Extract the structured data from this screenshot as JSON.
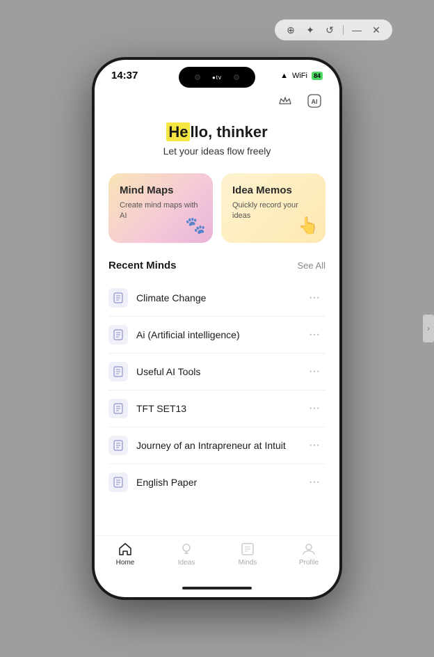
{
  "toolbar": {
    "icons": [
      "⊕",
      "✦",
      "↺",
      "—",
      "✕"
    ]
  },
  "phone": {
    "status_bar": {
      "time": "14:37",
      "signal": "▲▲▲",
      "wifi": "WiFi",
      "battery": "84"
    },
    "header": {
      "crown_icon": "👑",
      "ai_icon": "Ai"
    },
    "greeting": {
      "title_prefix": "",
      "highlight": "He",
      "title_main": "llo, thinker",
      "subtitle": "Let your ideas flow freely"
    },
    "cards": [
      {
        "id": "mind-maps",
        "title": "Mind Maps",
        "subtitle": "Create mind maps with AI",
        "icon": "🐾"
      },
      {
        "id": "idea-memos",
        "title": "Idea Memos",
        "subtitle": "Quickly record your ideas",
        "icon": "👆"
      }
    ],
    "recent": {
      "section_title": "Recent Minds",
      "see_all": "See All",
      "items": [
        {
          "label": "Climate Change"
        },
        {
          "label": "Ai (Artificial intelligence)"
        },
        {
          "label": "Useful AI Tools"
        },
        {
          "label": "TFT SET13"
        },
        {
          "label": "Journey of an Intrapreneur at Intuit"
        },
        {
          "label": "English Paper"
        }
      ]
    },
    "nav": [
      {
        "icon": "⬡",
        "label": "Home",
        "active": true
      },
      {
        "icon": "◯",
        "label": "Ideas",
        "active": false
      },
      {
        "icon": "◻",
        "label": "Minds",
        "active": false
      },
      {
        "icon": "◻",
        "label": "Profile",
        "active": false
      }
    ]
  }
}
